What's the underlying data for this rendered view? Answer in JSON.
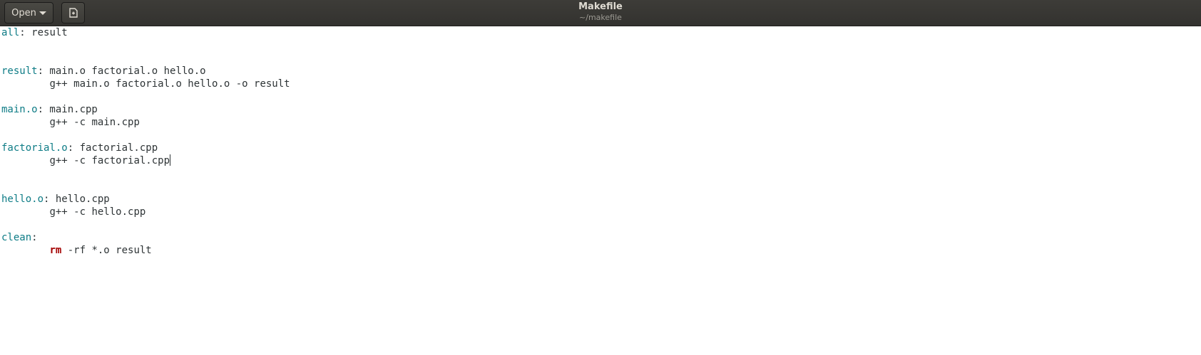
{
  "header": {
    "open_label": "Open",
    "title": "Makefile",
    "subtitle": "~/makefile"
  },
  "icons": {
    "open_dropdown": "chevron-down-icon",
    "new_document": "new-document-icon"
  },
  "colors": {
    "headerbar": "#3d3c38",
    "target": "#0e7c86",
    "command_keyword": "#a40000",
    "text": "#2e3436"
  },
  "editor": {
    "lines": [
      {
        "target": "all",
        "rest": ": result"
      },
      {
        "text": ""
      },
      {
        "text": ""
      },
      {
        "target": "result",
        "rest": ": main.o factorial.o hello.o"
      },
      {
        "indent": "        ",
        "text": "g++ main.o factorial.o hello.o -o result"
      },
      {
        "text": ""
      },
      {
        "target": "main.o",
        "rest": ": main.cpp"
      },
      {
        "indent": "        ",
        "text": "g++ -c main.cpp"
      },
      {
        "text": ""
      },
      {
        "target": "factorial.o",
        "rest": ": factorial.cpp"
      },
      {
        "indent": "        ",
        "text": "g++ -c factorial.cpp",
        "cursor": true
      },
      {
        "text": ""
      },
      {
        "text": ""
      },
      {
        "target": "hello.o",
        "rest": ": hello.cpp"
      },
      {
        "indent": "        ",
        "text": "g++ -c hello.cpp"
      },
      {
        "text": ""
      },
      {
        "target": "clean",
        "rest": ":"
      },
      {
        "indent": "        ",
        "cmd": "rm",
        "text": " -rf *.o result"
      }
    ]
  }
}
